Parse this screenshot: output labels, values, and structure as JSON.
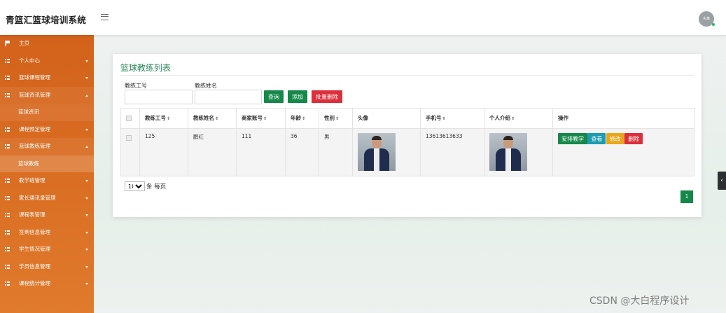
{
  "app": {
    "title": "青篮汇篮球培训系统",
    "avatar_text": "头像"
  },
  "sidebar": {
    "items": [
      {
        "label": "主页"
      },
      {
        "label": "个人中心"
      },
      {
        "label": "篮球课程管理"
      },
      {
        "label": "篮球资讯管理"
      },
      {
        "label": "篮球资讯",
        "sub": true
      },
      {
        "label": "课程预定管理"
      },
      {
        "label": "篮球教练管理"
      },
      {
        "label": "篮球教练",
        "sub": true
      },
      {
        "label": "教学班管理"
      },
      {
        "label": "家长通讯录管理"
      },
      {
        "label": "课程表管理"
      },
      {
        "label": "签到信息管理"
      },
      {
        "label": "学生情况管理"
      },
      {
        "label": "学员信息管理"
      },
      {
        "label": "课程统计管理"
      }
    ]
  },
  "panel": {
    "title": "篮球教练列表",
    "filters": {
      "coach_no_label": "教练工号",
      "coach_name_label": "教练姓名",
      "coach_no_value": "",
      "coach_name_value": ""
    },
    "buttons": {
      "search": "查询",
      "add": "添加",
      "batch_delete": "批量删除"
    }
  },
  "table": {
    "headers": [
      "教练工号",
      "教练姓名",
      "商家账号",
      "年龄",
      "性别",
      "头像",
      "手机号",
      "个人介绍",
      "操作"
    ],
    "rows": [
      {
        "coach_no": "125",
        "coach_name": "鹏红",
        "merchant_account": "111",
        "age": "36",
        "gender": "男",
        "phone": "13613613633"
      }
    ],
    "row_actions": {
      "schedule": "安排教学",
      "view": "查看",
      "edit": "修改",
      "delete": "删除"
    }
  },
  "pagination": {
    "page_size": "10",
    "page_size_suffix": "条 每页",
    "current_page": "1"
  },
  "handle_icon": "chevron-left",
  "watermark": "CSDN @大白程序设计",
  "colors": {
    "sidebar": "#d3621a",
    "primary_green": "#15884a",
    "danger_red": "#dc2f3b",
    "info_teal": "#1d9bb0",
    "warning_yellow": "#e9a51b"
  }
}
